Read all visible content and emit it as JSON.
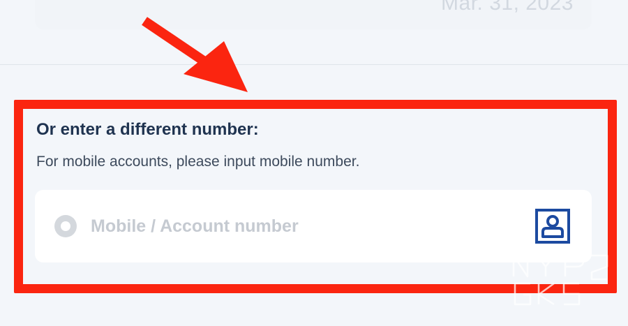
{
  "summary": {
    "date": "Mar. 31, 2023"
  },
  "number_entry": {
    "title": "Or enter a different number:",
    "subtitle": "For mobile accounts, please input mobile number.",
    "placeholder": "Mobile / Account number",
    "value": ""
  },
  "icons": {
    "radio": "radio-unselected-icon",
    "contact": "contact-picker-icon"
  },
  "colors": {
    "highlight": "#fb2510",
    "title_text": "#1f3350",
    "contact_icon": "#1c4aa0"
  }
}
